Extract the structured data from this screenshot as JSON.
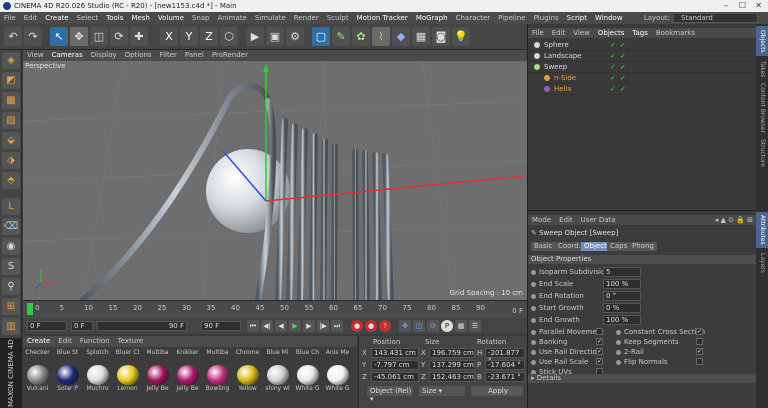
{
  "title": "CINEMA 4D R20.026 Studio (RC - R20) - [new1153.c4d *] - Main",
  "menu": [
    "File",
    "Edit",
    "Create",
    "Select",
    "Tools",
    "Mesh",
    "Volume",
    "Snap",
    "Animate",
    "Simulate",
    "Render",
    "Sculpt",
    "Motion Tracker",
    "MoGraph",
    "Character",
    "Pipeline",
    "Plugins",
    "Script",
    "Window"
  ],
  "layout": {
    "label": "Layout:",
    "value": "Standard"
  },
  "viewport": {
    "menu": [
      "View",
      "Cameras",
      "Display",
      "Options",
      "Filter",
      "Panel",
      "ProRender"
    ],
    "label": "Perspective",
    "grid_spacing": "Grid Spacing : 10 cm"
  },
  "timeline": {
    "ticks": [
      "0",
      "5",
      "10",
      "15",
      "20",
      "25",
      "30",
      "35",
      "40",
      "45",
      "50",
      "55",
      "60",
      "65",
      "70",
      "75",
      "80",
      "85",
      "90"
    ],
    "end_label": "0 F",
    "current": 0
  },
  "playbar": {
    "start": "0 F",
    "frame": "0 F",
    "end": "90 F",
    "end2": "90 F"
  },
  "materials": {
    "menu": [
      "Create",
      "Edit",
      "Function",
      "Texture"
    ],
    "row1": [
      "Checker",
      "Blue St",
      "Splotch",
      "Bluer Cl",
      "Multiba",
      "Knikker",
      "Multiba",
      "Chrome",
      "Blue Mi",
      "Blue Ch",
      "Anis Me"
    ],
    "row2": [
      "Vulcani",
      "Solar P",
      "Muchro",
      "Lemon",
      "Jelly Be",
      "Jelly Be",
      "Bowling",
      "Yellow",
      "shiny wl",
      "White G",
      "White G"
    ],
    "row2_colors": [
      "#8a8a8a",
      "#1a2a7a",
      "#dcdcdc",
      "#e8c820",
      "#a0145a",
      "#b01870",
      "#c43080",
      "#d8b818",
      "#d0d0d0",
      "#e8e8e8",
      "#f0f0f0"
    ]
  },
  "coords": {
    "headers": [
      "Position",
      "Size",
      "Rotation"
    ],
    "rows": [
      {
        "axis": "X",
        "pos": "143.431 cm",
        "size": "196.759 cm",
        "rot_axis": "H",
        "rot": "-201.877 °"
      },
      {
        "axis": "Y",
        "pos": "-7.797 cm",
        "size": "137.299 cm",
        "rot_axis": "P",
        "rot": "-17.604 °"
      },
      {
        "axis": "Z",
        "pos": "-45.061 cm",
        "size": "152.463 cm",
        "rot_axis": "B",
        "rot": "-23.671 °"
      }
    ],
    "mode": "Object (Rel)",
    "size_mode": "Size",
    "apply": "Apply"
  },
  "objects": {
    "menu": [
      "File",
      "Edit",
      "View",
      "Objects",
      "Tags",
      "Bookmarks"
    ],
    "items": [
      {
        "name": "Sphere",
        "color": "#cfd8e0",
        "indent": 0
      },
      {
        "name": "Landscape",
        "color": "#cfd8e0",
        "indent": 0
      },
      {
        "name": "Sweep",
        "color": "#9fe080",
        "indent": 0
      },
      {
        "name": "n-Side",
        "color": "#e0a040",
        "indent": 1
      },
      {
        "name": "Helix",
        "color": "#9060c0",
        "indent": 1
      }
    ]
  },
  "attributes": {
    "menu": [
      "Mode",
      "Edit",
      "User Data"
    ],
    "object_title": "Sweep Object [Sweep]",
    "tabs": [
      "Basic",
      "Coord.",
      "Object",
      "Caps",
      "Phong"
    ],
    "active_tab": "Object",
    "section": "Object Properties",
    "props": [
      {
        "label": "Isoparm Subdivision",
        "value": "5"
      },
      {
        "label": "End Scale",
        "value": "100 %"
      },
      {
        "label": "End Rotation",
        "value": "0 °"
      },
      {
        "label": "Start Growth",
        "value": "0 %"
      },
      {
        "label": "End Growth",
        "value": "100 %"
      }
    ],
    "checks_left": [
      {
        "label": "Parallel Movement",
        "checked": false
      },
      {
        "label": "Banking",
        "checked": true
      },
      {
        "label": "Use Rail Direction",
        "checked": true
      },
      {
        "label": "Use Rail Scale",
        "checked": true
      },
      {
        "label": "Stick UVs",
        "checked": false
      }
    ],
    "checks_right": [
      {
        "label": "Constant Cross Section",
        "checked": true
      },
      {
        "label": "Keep Segments",
        "checked": false
      },
      {
        "label": "2-Rail",
        "checked": true
      },
      {
        "label": "Flip Normals",
        "checked": false
      }
    ],
    "details": "Details"
  },
  "side_tabs": [
    "Objects",
    "Takes",
    "Content Browser",
    "Structure",
    "Attributes",
    "Layers"
  ],
  "maxon_label": "MAXON CINEMA 4D"
}
